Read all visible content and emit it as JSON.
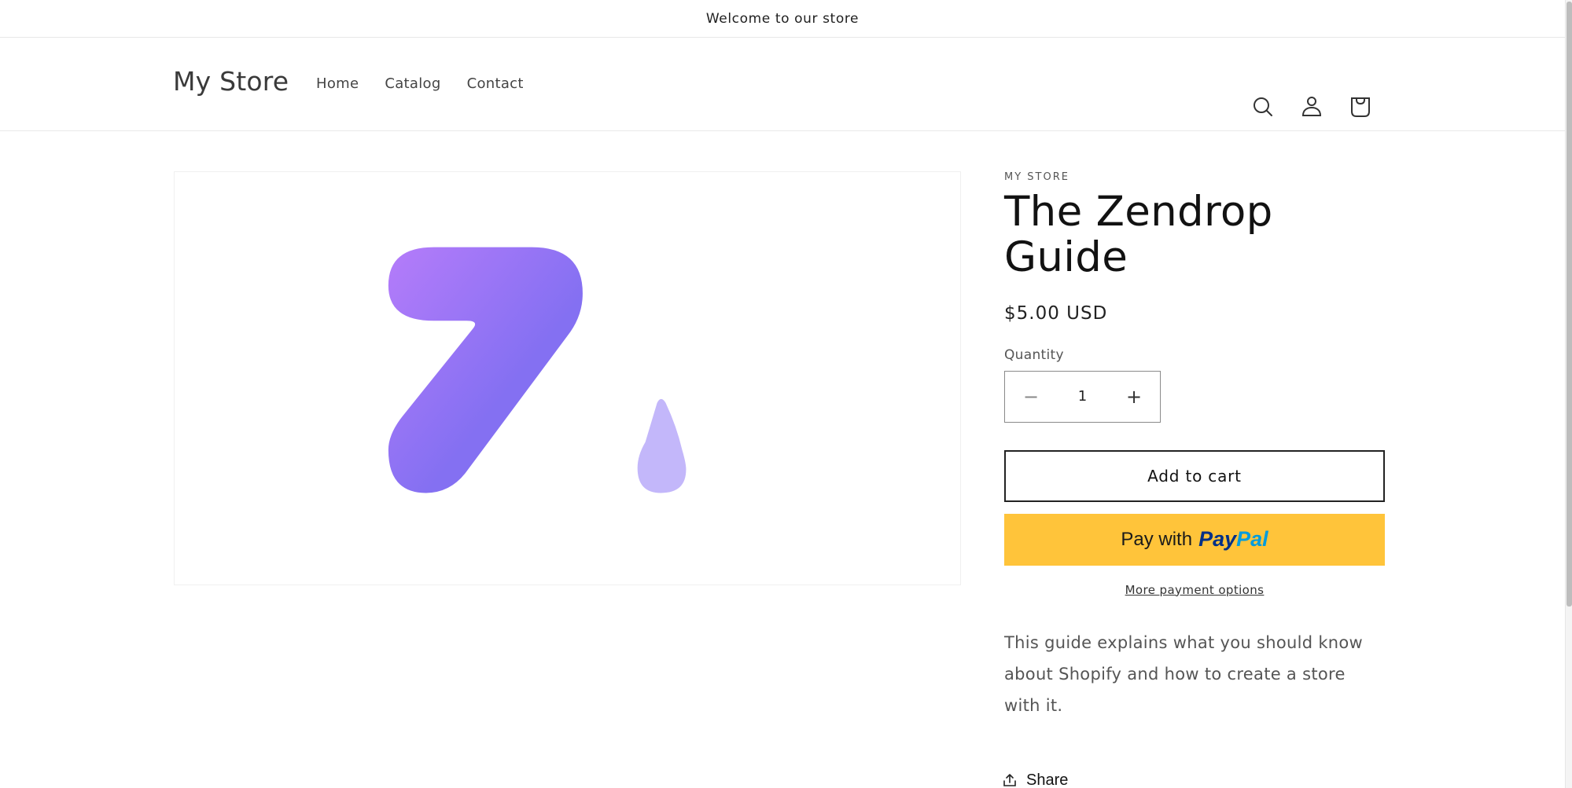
{
  "announcement": {
    "text": "Welcome to our store"
  },
  "header": {
    "logo": "My Store",
    "nav": [
      {
        "label": "Home"
      },
      {
        "label": "Catalog"
      },
      {
        "label": "Contact"
      }
    ],
    "icons": [
      "search-icon",
      "account-icon",
      "cart-icon"
    ]
  },
  "product": {
    "vendor": "MY STORE",
    "title": "The Zendrop Guide",
    "price": "$5.00 USD",
    "quantity_label": "Quantity",
    "quantity_value": "1",
    "decrease_symbol": "−",
    "increase_symbol": "+",
    "add_to_cart": "Add to cart",
    "paypal": {
      "prefix": "Pay with",
      "brand_part1": "Pay",
      "brand_part2": "Pal",
      "bg_color": "#ffc43a"
    },
    "more_payment_options": "More payment options",
    "description": "This guide explains what you should know about Shopify and how to create a store with it.",
    "share": "Share",
    "image": {
      "alt": "Zendrop logo",
      "gradient_start": "#b57cfa",
      "gradient_end": "#8470f2",
      "drop_color": "#c3b7fa"
    }
  }
}
